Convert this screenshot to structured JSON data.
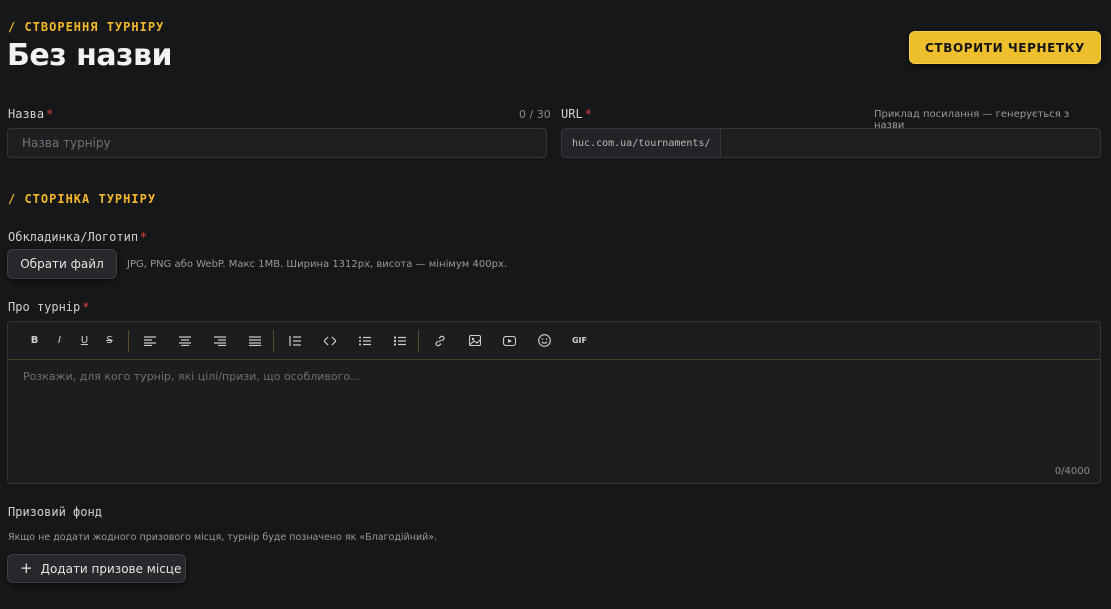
{
  "header": {
    "kicker": "/ СТВОРЕННЯ ТУРНІРУ",
    "title": "Без назви",
    "create_draft_label": "СТВОРИТИ ЧЕРНЕТКУ"
  },
  "name_field": {
    "label": "Назва",
    "required_mark": "*",
    "counter": "0 / 30",
    "placeholder": "Назва турніру"
  },
  "url_field": {
    "label": "URL",
    "required_mark": "*",
    "hint": "Приклад посилання — генерується з назви",
    "prefix": "huc.com.ua/tournaments/"
  },
  "page_section": {
    "kicker": "/ СТОРІНКА ТУРНІРУ"
  },
  "cover_field": {
    "label": "Обкладинка/Логотип",
    "required_mark": "*",
    "button_label": "Обрати файл",
    "hint": "JPG, PNG або WebP. Макс 1MB. Ширина 1312px, висота — мінімум 400px."
  },
  "about_field": {
    "label": "Про турнір",
    "required_mark": "*",
    "placeholder": "Розкажи, для кого турнір, які цілі/призи, що особливого...",
    "counter": "0/4000",
    "toolbar": {
      "bold": "B",
      "italic": "I",
      "underline": "U",
      "strike": "S",
      "gif": "GIF"
    }
  },
  "prize_field": {
    "label": "Призовий фонд",
    "hint": "Якщо не додати жодного призового місця, турнір буде позначено як «Благодійний».",
    "add_label": "Додати призове місце",
    "add_icon": "+"
  },
  "colors": {
    "accent": "#eebf2c",
    "background": "#161718",
    "required": "#e0413a"
  }
}
